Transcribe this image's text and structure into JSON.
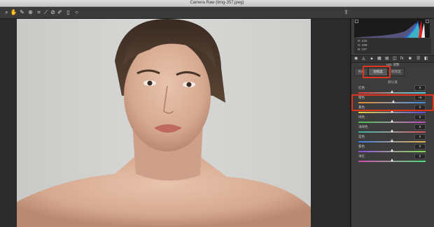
{
  "window": {
    "title": "Camera Raw (timg-357.jpeg)"
  },
  "toolbar": {
    "tools": [
      {
        "icon": "zoom-icon",
        "glyph": "⌕"
      },
      {
        "icon": "hand-icon",
        "glyph": "✋"
      },
      {
        "icon": "white-balance-icon",
        "glyph": "✎"
      },
      {
        "icon": "color-sampler-icon",
        "glyph": "⊕"
      },
      {
        "icon": "crop-icon",
        "glyph": "⌗"
      },
      {
        "icon": "straighten-icon",
        "glyph": "⟋"
      },
      {
        "icon": "spot-removal-icon",
        "glyph": "⊘"
      },
      {
        "icon": "brush-icon",
        "glyph": "✐"
      },
      {
        "icon": "trash-icon",
        "glyph": "▯"
      },
      {
        "icon": "rotate-icon",
        "glyph": "○"
      }
    ],
    "right_icon": {
      "icon": "export-icon",
      "glyph": "⇪"
    }
  },
  "readout": {
    "r": "R: 233",
    "g": "G: 209",
    "b": "B: 197"
  },
  "panel": {
    "section_title": "HSL 调整",
    "tabs": [
      "色相",
      "饱和度",
      "明亮度"
    ],
    "active_tab": 1,
    "group_label": "默认值",
    "sliders": [
      {
        "label": "红色",
        "value": "0",
        "level": 0.5
      },
      {
        "label": "橙色",
        "value": "+5",
        "level": 0.53
      },
      {
        "label": "黄色",
        "value": "0",
        "level": 0.5
      },
      {
        "label": "绿色",
        "value": "0",
        "level": 0.5
      },
      {
        "label": "浅绿色",
        "value": "0",
        "level": 0.5
      },
      {
        "label": "蓝色",
        "value": "0",
        "level": 0.5
      },
      {
        "label": "紫色",
        "value": "0",
        "level": 0.5
      },
      {
        "label": "洋红",
        "value": "0",
        "level": 0.5
      }
    ],
    "slider_gradients": [
      [
        "#e23a3a",
        "#9a9a9a",
        "#4ad0e0"
      ],
      [
        "#e88a2c",
        "#9a9a9a",
        "#3a8ae0"
      ],
      [
        "#e6d33a",
        "#9a9a9a",
        "#5a4ae0"
      ],
      [
        "#4ac04a",
        "#9a9a9a",
        "#c04ac0"
      ],
      [
        "#3ab0a0",
        "#9a9a9a",
        "#e04a5a"
      ],
      [
        "#3a7ae0",
        "#9a9a9a",
        "#e0b04a"
      ],
      [
        "#8a4ae0",
        "#9a9a9a",
        "#7ae04a"
      ],
      [
        "#d04ab0",
        "#9a9a9a",
        "#4ae07a"
      ]
    ]
  },
  "colors": {
    "highlight": "#e2331b",
    "background": "#2b2b2b",
    "panel": "#3c3c3c"
  }
}
